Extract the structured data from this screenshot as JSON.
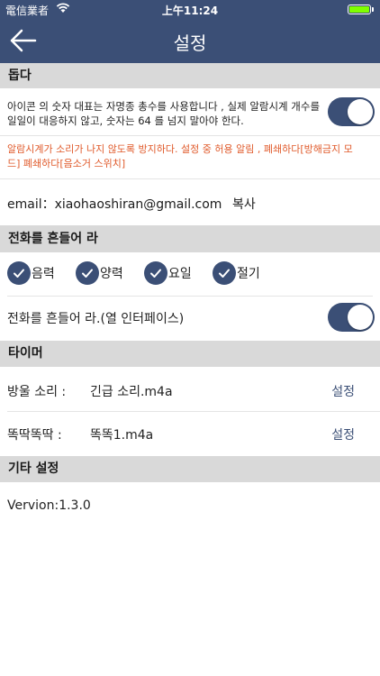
{
  "status": {
    "carrier": "電信業者",
    "time": "上午11:24"
  },
  "nav": {
    "title": "설정"
  },
  "sections": {
    "help": "돕다",
    "shake": "전화를 흔들어 라",
    "timer": "타이머",
    "other": "기타 설정"
  },
  "help": {
    "description_line1": "아이콘 의 숫자 대표는 자명종 총수를 사용합니다 , 실제 알람시계 개수를",
    "description_line2": "일일이 대응하지 않고, 숫자는 64 를 넘지 말아야 한다.",
    "badge_toggle_on": true,
    "warning_line1": "알람시계가 소리가 나지 않도록 방지하다.   설정 중 허용 알림 , 폐쇄하다[방해금지 모",
    "warning_line2": "드]  폐쇄하다[음소거 스위치]",
    "email": "email：xiaohaoshiran@gmail.com",
    "copy_label": "복사"
  },
  "shake": {
    "options": [
      {
        "label": "음력",
        "checked": true
      },
      {
        "label": "양력",
        "checked": true
      },
      {
        "label": "요일",
        "checked": true
      },
      {
        "label": "절기",
        "checked": true
      }
    ],
    "open_interface_label": "전화를 흔들어 라.(열 인터페이스)",
    "open_interface_on": true
  },
  "timer": {
    "rows": [
      {
        "label": "방울 소리 :",
        "value": "긴급 소리.m4a",
        "action": "설정"
      },
      {
        "label": "똑딱똑딱 :",
        "value": "똑똑1.m4a",
        "action": "설정"
      }
    ]
  },
  "other": {
    "version": "Vervion:1.3.0"
  },
  "colors": {
    "accent": "#3b4f76",
    "warning": "#e05a2b",
    "section_bg": "#d9d9d9"
  }
}
